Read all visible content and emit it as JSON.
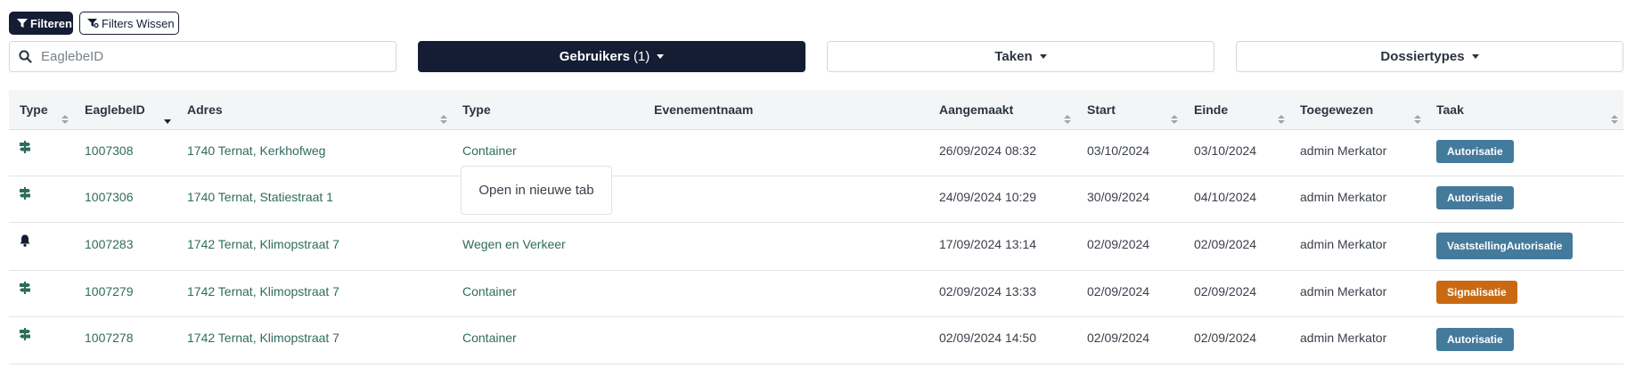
{
  "toolbar": {
    "filter_label": "Filteren",
    "clear_label": "Filters Wissen"
  },
  "search": {
    "placeholder": "EaglebeID",
    "value": ""
  },
  "dropdowns": {
    "users_label": "Gebruikers",
    "users_count": "(1)",
    "tasks_label": "Taken",
    "types_label": "Dossiertypes"
  },
  "table": {
    "headers": [
      "Type",
      "EaglebeID",
      "Adres",
      "Type",
      "Evenementnaam",
      "Aangemaakt",
      "Start",
      "Einde",
      "Toegewezen",
      "Taak"
    ],
    "rows": [
      {
        "icon": "signpost-icon",
        "id": "1007308",
        "address": "1740 Ternat, Kerkhofweg",
        "type": "Container",
        "event": "",
        "created": "26/09/2024 08:32",
        "start": "03/10/2024",
        "end": "03/10/2024",
        "assigned": "admin Merkator",
        "task": "Autorisatie",
        "task_color": "#447a9c"
      },
      {
        "icon": "signpost-icon",
        "id": "1007306",
        "address": "1740 Ternat, Statiestraat 1",
        "type": "",
        "event": "",
        "created": "24/09/2024 10:29",
        "start": "30/09/2024",
        "end": "04/10/2024",
        "assigned": "admin Merkator",
        "task": "Autorisatie",
        "task_color": "#447a9c"
      },
      {
        "icon": "bell-icon",
        "id": "1007283",
        "address": "1742 Ternat, Klimopstraat 7",
        "type": "Wegen en Verkeer",
        "event": "",
        "created": "17/09/2024 13:14",
        "start": "02/09/2024",
        "end": "02/09/2024",
        "assigned": "admin Merkator",
        "task": "VaststellingAutorisatie",
        "task_color": "#447a9c"
      },
      {
        "icon": "signpost-icon",
        "id": "1007279",
        "address": "1742 Ternat, Klimopstraat 7",
        "type": "Container",
        "event": "",
        "created": "02/09/2024 13:33",
        "start": "02/09/2024",
        "end": "02/09/2024",
        "assigned": "admin Merkator",
        "task": "Signalisatie",
        "task_color": "#c96a12"
      },
      {
        "icon": "signpost-icon",
        "id": "1007278",
        "address": "1742 Ternat, Klimopstraat 7",
        "type": "Container",
        "event": "",
        "created": "02/09/2024 14:50",
        "start": "02/09/2024",
        "end": "02/09/2024",
        "assigned": "admin Merkator",
        "task": "Autorisatie",
        "task_color": "#447a9c"
      }
    ]
  },
  "context_menu": {
    "item": "Open in nieuwe tab"
  },
  "colors": {
    "primary": "#151d35",
    "link": "#2f6b5e",
    "badge_blue": "#447a9c",
    "badge_orange": "#c96a12"
  }
}
